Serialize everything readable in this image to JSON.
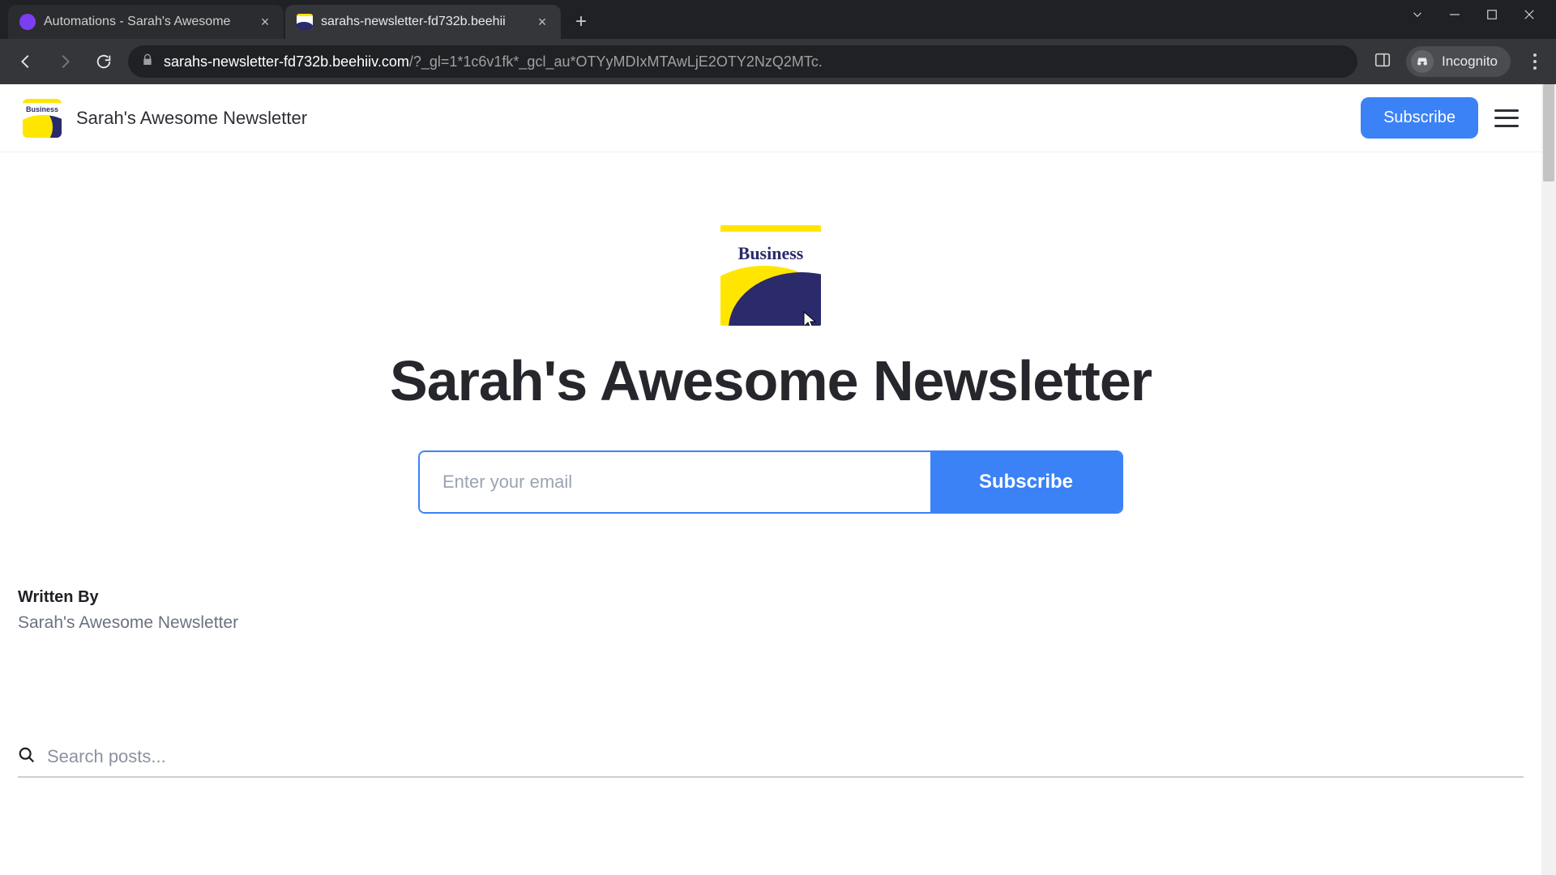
{
  "browser": {
    "tabs": [
      {
        "title": "Automations - Sarah's Awesome"
      },
      {
        "title": "sarahs-newsletter-fd732b.beehii"
      }
    ],
    "url_domain": "sarahs-newsletter-fd732b.beehiiv.com",
    "url_path": "/?_gl=1*1c6v1fk*_gcl_au*OTYyMDIxMTAwLjE2OTY2NzQ2MTc.",
    "incognito_label": "Incognito"
  },
  "header": {
    "site_name": "Sarah's Awesome Newsletter",
    "subscribe_label": "Subscribe",
    "logo_word": "Business"
  },
  "hero": {
    "logo_word": "Business",
    "title": "Sarah's Awesome Newsletter",
    "email_placeholder": "Enter your email",
    "subscribe_label": "Subscribe"
  },
  "meta": {
    "label": "Written By",
    "value": "Sarah's Awesome Newsletter"
  },
  "search": {
    "placeholder": "Search posts..."
  }
}
